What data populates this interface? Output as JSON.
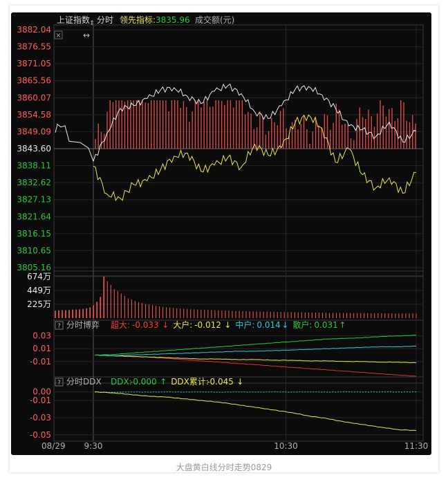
{
  "caption": "大盘黄白线分时走势0829",
  "colors": {
    "bg": "#0b0b0b",
    "grid": "#262626",
    "axis_border": "#3a3a3a",
    "up": "#ff5c5c",
    "down": "#28c840",
    "base": "#e6e6e6",
    "white_line": "#e8e8e8",
    "yellow_line": "#e8e84a",
    "cyan_bar": "#2ec6d6",
    "vol_bar": "#e05555",
    "label_gray": "#b0b0b0"
  },
  "header": {
    "index_name": "上证指数",
    "mode": "分时",
    "leading_label": "领先指标:",
    "leading_value": "3835.96",
    "volume_label": "成交额(元)"
  },
  "toolbar": {
    "close_glyph": "×",
    "arrows_glyph": "↔"
  },
  "chart_data": [
    {
      "id": "price",
      "type": "line",
      "series": [
        {
          "name": "上证指数",
          "color": "#e8e8e8",
          "x": [
            "09:30",
            "09:35",
            "09:40",
            "09:45",
            "09:50",
            "09:55",
            "10:00",
            "10:05",
            "10:10",
            "10:15",
            "10:20",
            "10:25",
            "10:30",
            "10:35",
            "10:40",
            "10:45",
            "10:50",
            "10:55",
            "11:00",
            "11:05",
            "11:10",
            "11:15",
            "11:20",
            "11:25",
            "11:30"
          ],
          "values": [
            3839.5,
            3848.5,
            3856.6,
            3857.5,
            3859.8,
            3862.6,
            3863.3,
            3860.5,
            3858.2,
            3862.2,
            3864.0,
            3861.4,
            3855.5,
            3853.3,
            3857.5,
            3862.8,
            3863.7,
            3861.0,
            3856.6,
            3851.0,
            3849.8,
            3847.5,
            3852.2,
            3845.8,
            3849.3
          ]
        },
        {
          "name": "领先指标",
          "color": "#e8e84a",
          "x": [
            "09:30",
            "09:35",
            "09:40",
            "09:45",
            "09:50",
            "09:55",
            "10:00",
            "10:05",
            "10:10",
            "10:15",
            "10:20",
            "10:25",
            "10:30",
            "10:35",
            "10:40",
            "10:45",
            "10:50",
            "10:55",
            "11:00",
            "11:05",
            "11:10",
            "11:15",
            "11:20",
            "11:25",
            "11:30"
          ],
          "values": [
            3838.0,
            3829.0,
            3827.6,
            3832.0,
            3833.2,
            3836.8,
            3841.2,
            3842.2,
            3836.3,
            3838.3,
            3840.8,
            3837.6,
            3845.0,
            3841.5,
            3844.0,
            3852.0,
            3854.5,
            3850.2,
            3839.2,
            3843.6,
            3835.2,
            3830.9,
            3834.2,
            3829.2,
            3835.9
          ]
        }
      ],
      "pre_close_x": "08:29",
      "pre_close_value": 3843.6,
      "ylim": [
        3805.16,
        3882.04
      ],
      "y_ticks": [
        "3882.04",
        "3876.55",
        "3871.05",
        "3865.56",
        "3860.07",
        "3854.58",
        "3849.09",
        "3843.60",
        "3838.11",
        "3832.62",
        "3827.13",
        "3821.64",
        "3816.15",
        "3810.65",
        "3805.16"
      ]
    },
    {
      "id": "volume",
      "type": "bar",
      "y_ticks": [
        "674万",
        "449万",
        "225万"
      ],
      "ylim": [
        0,
        674
      ],
      "unit": "万",
      "values": [
        120,
        125,
        130,
        128,
        132,
        138,
        140,
        142,
        150,
        160,
        175,
        210,
        265,
        342,
        674,
        600,
        540,
        470,
        440,
        400,
        360,
        320,
        300,
        280,
        260,
        245,
        230,
        220,
        210,
        200,
        190,
        182,
        176,
        170,
        165,
        160,
        156,
        152,
        148,
        145,
        142,
        140,
        138,
        135,
        132,
        130,
        128,
        126,
        124,
        122,
        120,
        118,
        116,
        115,
        114,
        112,
        110,
        109,
        108,
        106,
        105,
        104,
        103,
        102,
        101,
        100,
        99,
        98,
        97,
        96,
        95,
        94,
        93,
        92,
        91,
        90,
        89,
        88,
        87,
        86,
        85,
        85,
        84,
        84,
        83,
        83,
        82,
        82,
        81,
        81,
        80,
        80,
        80,
        79,
        79,
        78,
        78,
        78,
        77,
        77,
        76,
        76,
        76,
        75,
        75
      ]
    },
    {
      "id": "boyi",
      "type": "line",
      "panel_title": "分时博弈",
      "help_glyph": "?",
      "legend": [
        {
          "label": "超大:",
          "value": "-0.033",
          "arrow": "↓",
          "color": "#ff3b3b"
        },
        {
          "label": "大户:",
          "value": "-0.012",
          "arrow": "↓",
          "color": "#e8e84a"
        },
        {
          "label": "中户:",
          "value": "0.014",
          "arrow": "↓",
          "color": "#2ec6d6"
        },
        {
          "label": "散户:",
          "value": "0.031",
          "arrow": "↑",
          "color": "#28c840"
        }
      ],
      "ylim": [
        -0.035,
        0.035
      ],
      "y_ticks": [
        "0.03",
        "0.01",
        "-0.01"
      ],
      "series": [
        {
          "name": "超大",
          "color": "#e03030",
          "values": [
            0.0,
            -0.001,
            -0.002,
            -0.003,
            -0.005,
            -0.007,
            -0.009,
            -0.011,
            -0.013,
            -0.015,
            -0.017,
            -0.019,
            -0.021,
            -0.023,
            -0.025,
            -0.027,
            -0.029,
            -0.031,
            -0.033
          ]
        },
        {
          "name": "大户",
          "color": "#e8e84a",
          "values": [
            0.0,
            -0.001,
            -0.002,
            -0.003,
            -0.004,
            -0.005,
            -0.006,
            -0.006,
            -0.007,
            -0.007,
            -0.008,
            -0.008,
            -0.009,
            -0.009,
            -0.01,
            -0.01,
            -0.011,
            -0.011,
            -0.012
          ]
        },
        {
          "name": "中户",
          "color": "#2ec6d6",
          "values": [
            0.0,
            -0.001,
            0.0,
            0.001,
            0.002,
            0.003,
            0.004,
            0.005,
            0.006,
            0.006,
            0.007,
            0.008,
            0.009,
            0.01,
            0.011,
            0.012,
            0.013,
            0.013,
            0.014
          ]
        },
        {
          "name": "散户",
          "color": "#28c840",
          "values": [
            0.0,
            0.001,
            0.003,
            0.005,
            0.007,
            0.009,
            0.011,
            0.013,
            0.015,
            0.017,
            0.019,
            0.021,
            0.023,
            0.025,
            0.026,
            0.027,
            0.029,
            0.03,
            0.031
          ]
        }
      ]
    },
    {
      "id": "ddx",
      "type": "line",
      "panel_title": "分时DDX",
      "help_glyph": "?",
      "legend": [
        {
          "label": "DDX:",
          "value": "-0.000",
          "arrow": "↑",
          "color": "#28c840"
        },
        {
          "label": "DDX累计:",
          "value": "-0.045",
          "arrow": "↓",
          "color": "#e8e84a"
        }
      ],
      "ylim": [
        -0.055,
        0.003
      ],
      "y_ticks": [
        "0.00",
        "-0.01",
        "-0.03",
        "-0.05"
      ],
      "series": [
        {
          "name": "DDX",
          "color": "#2ec6d6",
          "values": [
            0.0,
            -0.0005,
            0.0,
            -0.0003,
            0.0,
            -0.0002,
            0.0,
            -0.0004,
            0.0,
            -0.0003,
            0.0,
            -0.0002,
            0.0,
            -0.0003,
            0.0,
            -0.0002,
            0.0,
            -0.0001,
            0.0
          ]
        },
        {
          "name": "DDX累计",
          "color": "#e8e84a",
          "values": [
            0.0,
            -0.001,
            -0.003,
            -0.005,
            -0.006,
            -0.008,
            -0.01,
            -0.012,
            -0.015,
            -0.018,
            -0.021,
            -0.024,
            -0.028,
            -0.031,
            -0.035,
            -0.038,
            -0.041,
            -0.044,
            -0.045
          ]
        }
      ]
    },
    {
      "id": "time_axis",
      "type": "table",
      "x_ticks": [
        "08/29",
        "9:30",
        "10:30",
        "11:30"
      ]
    }
  ]
}
